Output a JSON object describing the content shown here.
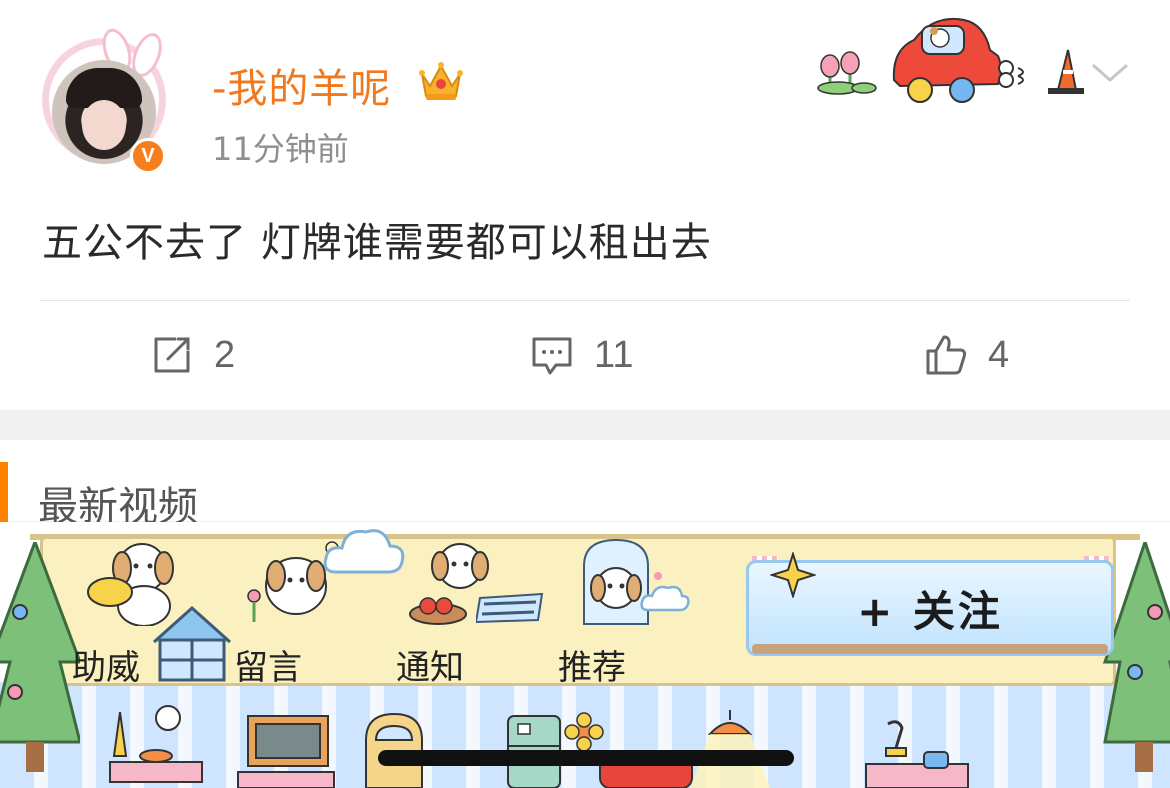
{
  "post": {
    "username": "-我的羊呢",
    "time": "11分钟前",
    "content": "五公不去了 灯牌谁需要都可以租出去",
    "verified_mark": "V",
    "actions": {
      "repost_count": "2",
      "comment_count": "11",
      "like_count": "4"
    },
    "icons": [
      "crown-icon",
      "chevron-down-icon",
      "repost-icon",
      "comment-icon",
      "like-icon"
    ]
  },
  "section": {
    "title": "最新视频"
  },
  "banner": {
    "menu": [
      {
        "label": "助威"
      },
      {
        "label": "留言"
      },
      {
        "label": "通知"
      },
      {
        "label": "推荐"
      }
    ],
    "follow_label": "+ 关注"
  },
  "colors": {
    "username": "#f2781e",
    "accent": "#ff8200",
    "verified": "#f77f1b"
  }
}
